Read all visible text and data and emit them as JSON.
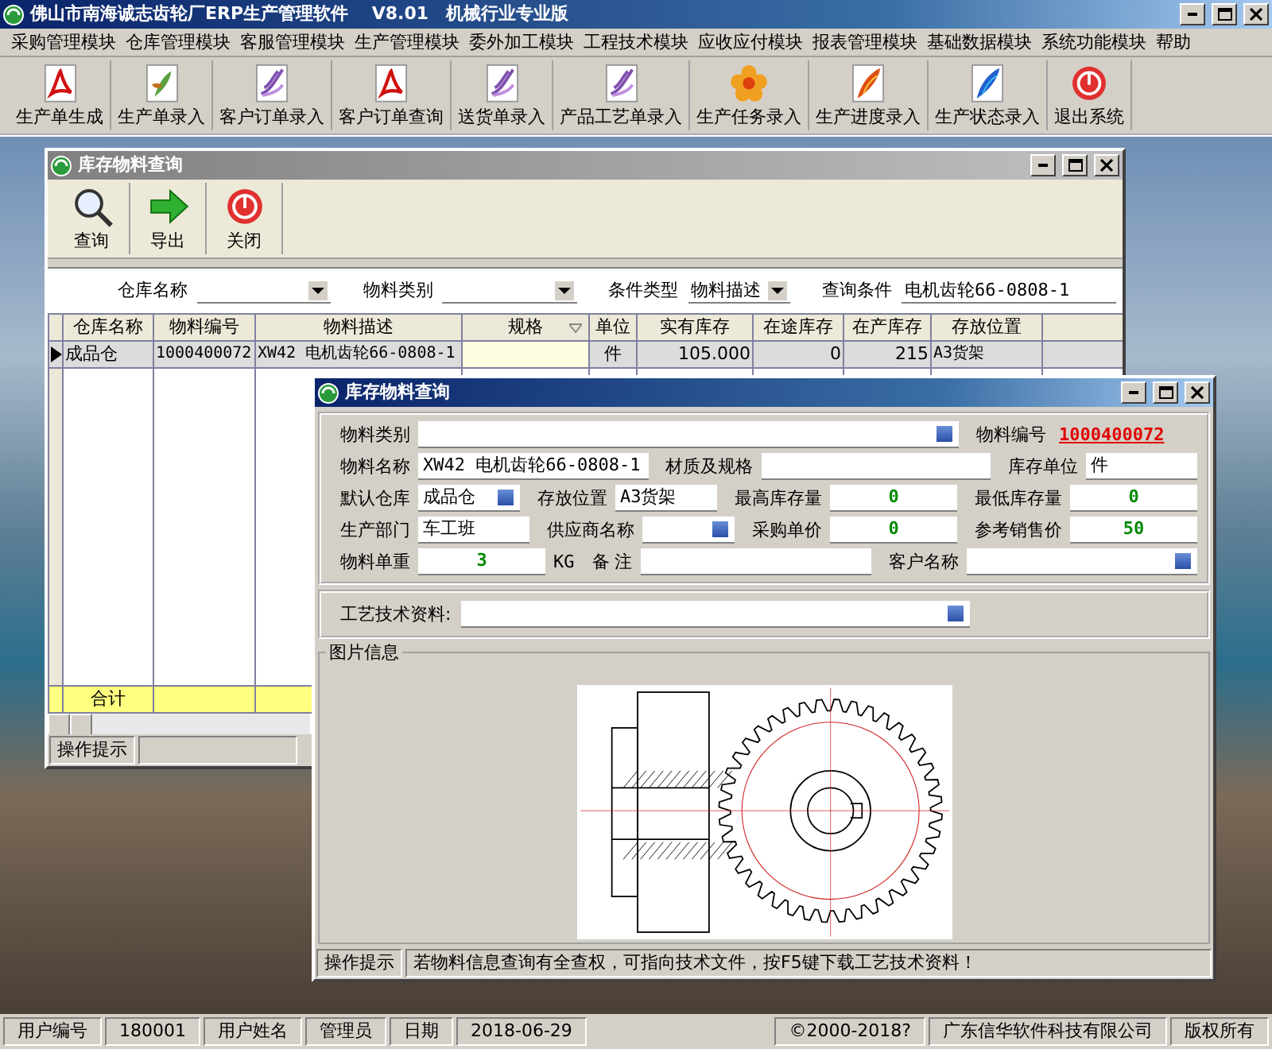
{
  "app_window": {
    "title": "佛山市南海诚志齿轮厂ERP生产管理软件　 V8.01　机械行业专业版"
  },
  "menu": [
    "采购管理模块",
    "仓库管理模块",
    "客服管理模块",
    "生产管理模块",
    "委外加工模块",
    "工程技术模块",
    "应收应付模块",
    "报表管理模块",
    "基础数据模块",
    "系统功能模块",
    "帮助"
  ],
  "toolbar": [
    {
      "label": "生产单生成",
      "kind": "pdf"
    },
    {
      "label": "生产单录入",
      "kind": "leaf"
    },
    {
      "label": "客户订单录入",
      "kind": "swirl"
    },
    {
      "label": "客户订单查询",
      "kind": "pdf"
    },
    {
      "label": "送货单录入",
      "kind": "swirl"
    },
    {
      "label": "产品工艺单录入",
      "kind": "swirl"
    },
    {
      "label": "生产任务录入",
      "kind": "flower"
    },
    {
      "label": "生产进度录入",
      "kind": "feather"
    },
    {
      "label": "生产状态录入",
      "kind": "quill"
    },
    {
      "label": "退出系统",
      "kind": "exit"
    }
  ],
  "query_window": {
    "title": "库存物料查询",
    "toolbar": [
      {
        "label": "查询",
        "kind": "search"
      },
      {
        "label": "导出",
        "kind": "export"
      },
      {
        "label": "关闭",
        "kind": "close"
      }
    ],
    "filters": [
      {
        "label": "仓库名称",
        "kind": "combo"
      },
      {
        "label": "物料类别",
        "kind": "combo"
      },
      {
        "label": "条件类型",
        "kind": "combo",
        "value": "物料描述"
      },
      {
        "label": "查询条件",
        "kind": "text",
        "value": "电机齿轮66-0808-1"
      }
    ],
    "grid": {
      "columns": [
        {
          "label": "仓库名称",
          "kind": "text"
        },
        {
          "label": "物料编号",
          "kind": "text"
        },
        {
          "label": "物料描述",
          "kind": "text"
        },
        {
          "label": "规格",
          "kind": "filter"
        },
        {
          "label": "单位",
          "kind": "center"
        },
        {
          "label": "实有库存",
          "kind": "number"
        },
        {
          "label": "在途库存",
          "kind": "number"
        },
        {
          "label": "在产库存",
          "kind": "number"
        },
        {
          "label": "存放位置",
          "kind": "text"
        }
      ],
      "rows": [
        {
          "selected": true,
          "cells": [
            "成品仓",
            "1000400072",
            "XW42 电机齿轮66-0808-1",
            null,
            "件",
            "105.000",
            "0",
            "215",
            "A3货架"
          ]
        }
      ],
      "total_label": "合计"
    },
    "status_label": "操作提示"
  },
  "detail_window": {
    "title": "库存物料查询",
    "form": [
      [
        {
          "label": "物料类别",
          "kind": "lookup"
        },
        {
          "label": "物料编号",
          "kind": "code",
          "value": "1000400072"
        }
      ],
      [
        {
          "label": "物料名称",
          "kind": "text",
          "value": "XW42 电机齿轮66-0808-1"
        },
        {
          "label": "材质及规格",
          "kind": "text"
        },
        {
          "label": "库存单位",
          "kind": "short",
          "value": "件"
        }
      ],
      [
        {
          "label": "默认仓库",
          "kind": "lookup",
          "value": "成品仓"
        },
        {
          "label": "存放位置",
          "kind": "text",
          "value": "A3货架"
        },
        {
          "label": "最高库存量",
          "kind": "number",
          "value": "0"
        },
        {
          "label": "最低库存量",
          "kind": "number",
          "value": "0"
        }
      ],
      [
        {
          "label": "生产部门",
          "kind": "short",
          "value": "车工班"
        },
        {
          "label": "供应商名称",
          "kind": "lookup"
        },
        {
          "label": "采购单价",
          "kind": "number",
          "value": "0"
        },
        {
          "label": "参考销售价",
          "kind": "number",
          "value": "50"
        }
      ],
      [
        {
          "label": "物料单重",
          "kind": "number",
          "value": "3",
          "unit": "KG"
        },
        {
          "label": "备 注",
          "kind": "text"
        },
        {
          "label": "客户名称",
          "kind": "lookup"
        }
      ]
    ],
    "tech_label": "工艺技术资料:",
    "picture_label": "图片信息",
    "status_label": "操作提示",
    "status_text": "若物料信息查询有全查权，可指向技术文件，按F5键下载工艺技术资料！"
  },
  "status_bar": [
    "用户编号",
    "180001",
    "用户姓名",
    "管理员",
    "日期",
    "2018-06-29",
    "©2000-2018?",
    "广东信华软件科技有限公司",
    "版权所有"
  ]
}
